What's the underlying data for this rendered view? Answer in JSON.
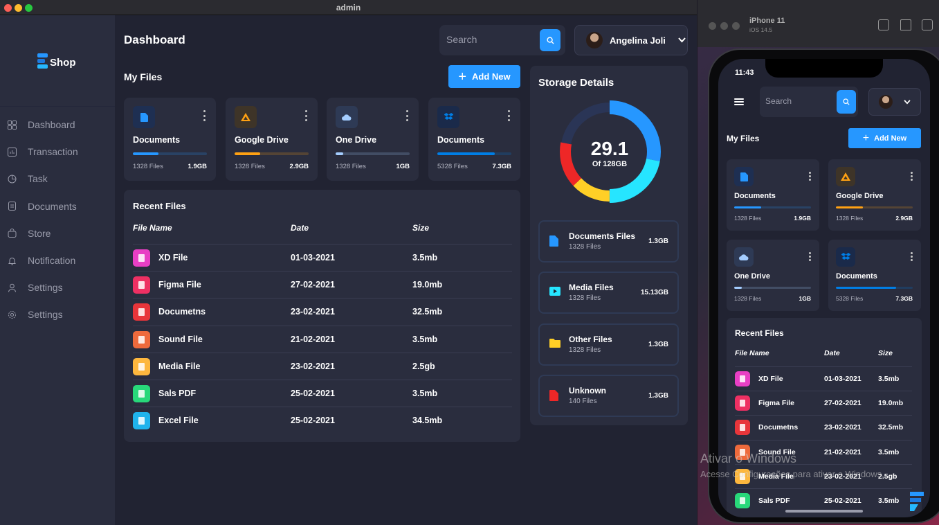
{
  "window": {
    "title": "admin"
  },
  "colors": {
    "primary": "#2697ff",
    "bg": "#212332",
    "card": "#2a2d3e",
    "text_muted": "#9a9cab"
  },
  "brand": {
    "logo_text": "Shop"
  },
  "sidebar": {
    "items": [
      {
        "label": "Dashboard",
        "icon": "grid-icon"
      },
      {
        "label": "Transaction",
        "icon": "chart-icon"
      },
      {
        "label": "Task",
        "icon": "pie-icon"
      },
      {
        "label": "Documents",
        "icon": "document-icon"
      },
      {
        "label": "Store",
        "icon": "bag-icon"
      },
      {
        "label": "Notification",
        "icon": "bell-icon"
      },
      {
        "label": "Settings",
        "icon": "user-icon"
      },
      {
        "label": "Settings",
        "icon": "gear-icon"
      }
    ]
  },
  "header": {
    "title": "Dashboard",
    "search_placeholder": "Search",
    "profile_name": "Angelina Joli"
  },
  "my_files": {
    "title": "My Files",
    "add_label": "Add New",
    "cards": [
      {
        "title": "Documents",
        "files": "1328 Files",
        "size": "1.9GB",
        "color": "#2697ff",
        "fill_percent": 35
      },
      {
        "title": "Google Drive",
        "files": "1328 Files",
        "size": "2.9GB",
        "color": "#ffa113",
        "fill_percent": 35
      },
      {
        "title": "One Drive",
        "files": "1328 Files",
        "size": "1GB",
        "color": "#a4cdff",
        "fill_percent": 10
      },
      {
        "title": "Documents",
        "files": "5328 Files",
        "size": "7.3GB",
        "color": "#007ee5",
        "fill_percent": 78
      }
    ]
  },
  "recent_files": {
    "title": "Recent Files",
    "columns": [
      "File Name",
      "Date",
      "Size"
    ],
    "rows": [
      {
        "name": "XD File",
        "date": "01-03-2021",
        "size": "3.5mb",
        "color": "#e83fc4"
      },
      {
        "name": "Figma File",
        "date": "27-02-2021",
        "size": "19.0mb",
        "color": "#ee3063"
      },
      {
        "name": "Documetns",
        "date": "23-02-2021",
        "size": "32.5mb",
        "color": "#e8353a"
      },
      {
        "name": "Sound File",
        "date": "21-02-2021",
        "size": "3.5mb",
        "color": "#ee6a3c"
      },
      {
        "name": "Media File",
        "date": "23-02-2021",
        "size": "2.5gb",
        "color": "#fdb73e"
      },
      {
        "name": "Sals PDF",
        "date": "25-02-2021",
        "size": "3.5mb",
        "color": "#28d87a"
      },
      {
        "name": "Excel File",
        "date": "25-02-2021",
        "size": "34.5mb",
        "color": "#1fb3ec"
      }
    ]
  },
  "storage": {
    "title": "Storage Details",
    "used": "29.1",
    "total_label": "Of 128GB",
    "segments": [
      {
        "name": "blue",
        "color": "#2697ff",
        "percent": 28
      },
      {
        "name": "cyan",
        "color": "#26e5ff",
        "percent": 22
      },
      {
        "name": "yellow",
        "color": "#ffcf26",
        "percent": 13
      },
      {
        "name": "red",
        "color": "#ee2727",
        "percent": 15
      },
      {
        "name": "free",
        "color": "#2a3556",
        "percent": 22
      }
    ],
    "items": [
      {
        "name": "Documents Files",
        "count": "1328 Files",
        "size": "1.3GB",
        "color": "#2697ff"
      },
      {
        "name": "Media Files",
        "count": "1328 Files",
        "size": "15.13GB",
        "color": "#26e5ff"
      },
      {
        "name": "Other Files",
        "count": "1328 Files",
        "size": "1.3GB",
        "color": "#ffcf26"
      },
      {
        "name": "Unknown",
        "count": "140 Files",
        "size": "1.3GB",
        "color": "#ee2727"
      }
    ]
  },
  "simulator": {
    "device": "iPhone 11",
    "os": "iOS 14.5",
    "time": "11:43"
  },
  "mobile": {
    "search_placeholder": "Search",
    "my_files_title": "My Files",
    "add_label": "Add New",
    "recent_title": "Recent Files",
    "visible_rows": [
      "XD File",
      "Figma File",
      "Documetns",
      "Sound File",
      "Media File",
      "Sals PDF"
    ]
  },
  "watermark": {
    "line1": "Ativar o Windows",
    "line2": "Acesse Configurações para ativar o Windows."
  }
}
